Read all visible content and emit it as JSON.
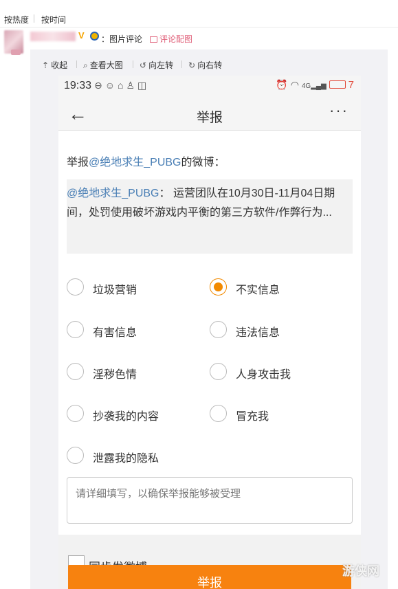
{
  "sort": {
    "hot": "按热度",
    "time": "按时间"
  },
  "comment": {
    "source": "：图片评论",
    "pic_comment": "评论配图"
  },
  "toolbar": {
    "collapse": "收起",
    "view_large": "查看大图",
    "rotate_left": "向左转",
    "rotate_right": "向右转"
  },
  "status": {
    "time": "19:33",
    "battery": "7"
  },
  "nav": {
    "title": "举报",
    "more": "···"
  },
  "report": {
    "prefix": "举报",
    "target": "@绝地求生_PUBG",
    "suffix": "的微博：",
    "quote_mention": "@绝地求生_PUBG",
    "quote_text": "： 运营团队在10月30日-11月04日期间，处罚使用破坏游戏内平衡的第三方软件/作弊行为..."
  },
  "options": [
    {
      "label": "垃圾营销",
      "selected": false
    },
    {
      "label": "不实信息",
      "selected": true
    },
    {
      "label": "有害信息",
      "selected": false
    },
    {
      "label": "违法信息",
      "selected": false
    },
    {
      "label": "淫秽色情",
      "selected": false
    },
    {
      "label": "人身攻击我",
      "selected": false
    },
    {
      "label": "抄袭我的内容",
      "selected": false
    },
    {
      "label": "冒充我",
      "selected": false
    },
    {
      "label": "泄露我的隐私",
      "selected": false
    }
  ],
  "detail_placeholder": "请详细填写，以确保举报能够被受理",
  "sync_label": "同步发微博",
  "submit_label": "举报",
  "watermark": "游侠网",
  "colors": {
    "accent": "#f7820f",
    "mention": "#4a7fb5",
    "pic_comment": "#e0617a"
  }
}
